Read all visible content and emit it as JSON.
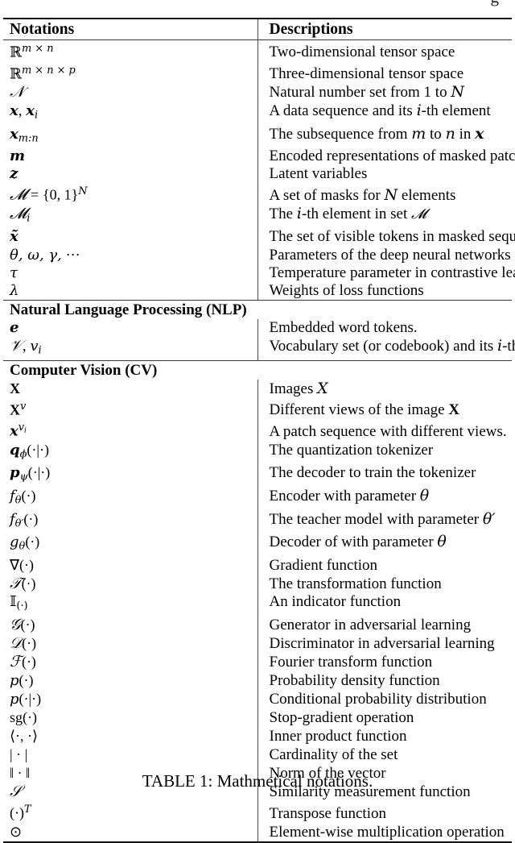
{
  "artifact": {
    "glyph": "g"
  },
  "table": {
    "headers": {
      "notations": "Notations",
      "descriptions": "Descriptions"
    },
    "sections": [
      {
        "label": null,
        "rows": [
          {
            "notation_html": "<span class=\"bb\">ℝ</span><sup>m × n</sup>",
            "description": "Two-dimensional tensor space"
          },
          {
            "notation_html": "<span class=\"bb\">ℝ</span><sup>m × n × p</sup>",
            "description": "Three-dimensional tensor space"
          },
          {
            "notation_html": "<span class=\"cal\">𝒩</span>",
            "description_html": "Natural number set from 1 to <span class=\"mi\">N</span>"
          },
          {
            "notation_html": "<span class=\"mb\">x</span>, <span class=\"mb\">x</span><sub>i</sub>",
            "description_html": "A data sequence and its <span class=\"mi\">i</span>-th element"
          },
          {
            "notation_html": "<span class=\"mb\">x</span><sub>m:n</sub>",
            "description_html": "The subsequence from <span class=\"mi\">m</span> to <span class=\"mi\">n</span> in <span class=\"mbb\">x</span>"
          },
          {
            "notation_html": "<span class=\"mb\">m</span>",
            "description": "Encoded representations of masked patch/token"
          },
          {
            "notation_html": "<span class=\"mb\">z</span>",
            "description": "Latent variables"
          },
          {
            "notation_html": "<span class=\"cal\">𝓜</span> <span class=\"mr\">=</span> <span class=\"mr\">{0, 1}</span><sup>N</sup>",
            "description_html": "A set of masks for <span class=\"mi\">N</span> elements"
          },
          {
            "notation_html": "<span class=\"cal\">𝓜</span><sub>i</sub>",
            "description_html": "The <span class=\"mi\">i</span>-th element in set <span class=\"cal\" style=\"font-size:17px\">𝓜</span>"
          },
          {
            "notation_html": "<span class=\"mb\">x̃</span>",
            "description": "The set of visible tokens in masked sequence"
          },
          {
            "notation_html": "<span class=\"m\">θ, ω, γ,</span> <span class=\"mr\">⋯</span>",
            "description": "Parameters of the deep neural networks"
          },
          {
            "notation_html": "<span class=\"m\">τ</span>",
            "description": "Temperature parameter in contrastive learning"
          },
          {
            "notation_html": "<span class=\"m\">λ</span>",
            "description": "Weights of loss functions"
          }
        ]
      },
      {
        "label": "Natural Language Processing (NLP)",
        "rows": [
          {
            "notation_html": "<span class=\"mb\">e</span>",
            "description": "Embedded word tokens."
          },
          {
            "notation_html": "<span class=\"cal\">𝒱</span>, <span class=\"m\">v</span><sub>i</sub>",
            "description_html": "Vocabulary set (or codebook) and its <span class=\"mi\">i</span>-th elements"
          }
        ]
      },
      {
        "label": "Computer Vision (CV)",
        "rows": [
          {
            "notation_html": "<span class=\"mr\" style=\"font-weight:bold\">X</span>",
            "description_html": "Images <span class=\"mi\">X</span>"
          },
          {
            "notation_html": "<span class=\"mr\" style=\"font-weight:bold\">X</span><sup>v</sup>",
            "description_html": "Different views of the image <span class=\"up\" style=\"font-weight:bold\">X</span>"
          },
          {
            "notation_html": "<span class=\"mb\">x</span><sup>v<sub style=\"font-size:0.7em\">i</sub></sup>",
            "description": "A patch sequence with different views."
          },
          {
            "notation_html": "<span class=\"mb\">q</span><sub>ϕ</sub><span class=\"mr\">(·|·)</span>",
            "description": "The quantization tokenizer"
          },
          {
            "notation_html": "<span class=\"mb\">p</span><sub>ψ</sub><span class=\"mr\">(·|·)</span>",
            "description": "The decoder to train the tokenizer"
          },
          {
            "notation_html": "<span class=\"m\">f</span><sub>θ</sub><span class=\"mr\">(·)</span>",
            "description_html": "Encoder with parameter <span class=\"mi\">θ</span>"
          },
          {
            "notation_html": "<span class=\"m\">f</span><sub>θ′</sub><span class=\"mr\">(·)</span>",
            "description_html": "The teacher model with parameter <span class=\"mi\">θ′</span>"
          },
          {
            "notation_html": "<span class=\"m\">g</span><sub>θ</sub><span class=\"mr\">(·)</span>",
            "description_html": "Decoder of with parameter <span class=\"mi\">θ</span>"
          },
          {
            "notation_html": "<span class=\"mr\">∇(·)</span>",
            "description": "Gradient function"
          },
          {
            "notation_html": "<span class=\"cal\">𝒯</span><span class=\"mr\">(·)</span>",
            "description": "The transformation function"
          },
          {
            "notation_html": "<span class=\"bb\">𝕀</span><sub style=\"font-style:normal\">(·)</sub>",
            "description": "An indicator function"
          },
          {
            "notation_html": "<span class=\"cal\">𝒢</span><span class=\"mr\">(·)</span>",
            "description": "Generator in adversarial learning"
          },
          {
            "notation_html": "<span class=\"cal\">𝒟</span><span class=\"mr\">(·)</span>",
            "description": "Discriminator in adversarial learning"
          },
          {
            "notation_html": "<span class=\"cal\">ℱ</span><span class=\"mr\">(·)</span>",
            "description": "Fourier transform function"
          },
          {
            "notation_html": "<span class=\"m\">p</span><span class=\"mr\">(·)</span>",
            "description": "Probability density function"
          },
          {
            "notation_html": "<span class=\"m\">p</span><span class=\"mr\">(·|·)</span>",
            "description": "Conditional probability distribution"
          },
          {
            "notation_html": "<span class=\"mr\">sg(·)</span>",
            "description": "Stop-gradient operation"
          },
          {
            "notation_html": "<span class=\"mr\">⟨·, ·⟩</span>",
            "description": "Inner product function"
          },
          {
            "notation_html": "<span class=\"mr\">| · |</span>",
            "description": "Cardinality of the set"
          },
          {
            "notation_html": "<span class=\"mr\">‖ · ‖</span>",
            "description": "Norm of the vector"
          },
          {
            "notation_html": "<span class=\"cal\">𝒮</span>",
            "description": "Similarity measurement function"
          },
          {
            "notation_html": "<span class=\"mr\">(·)</span><sup>T</sup>",
            "description": "Transpose function"
          },
          {
            "notation_html": "<span class=\"mr\">⊙</span>",
            "description": "Element-wise multiplication operation"
          }
        ]
      }
    ]
  },
  "caption": "TABLE 1: Mathmetical notations."
}
